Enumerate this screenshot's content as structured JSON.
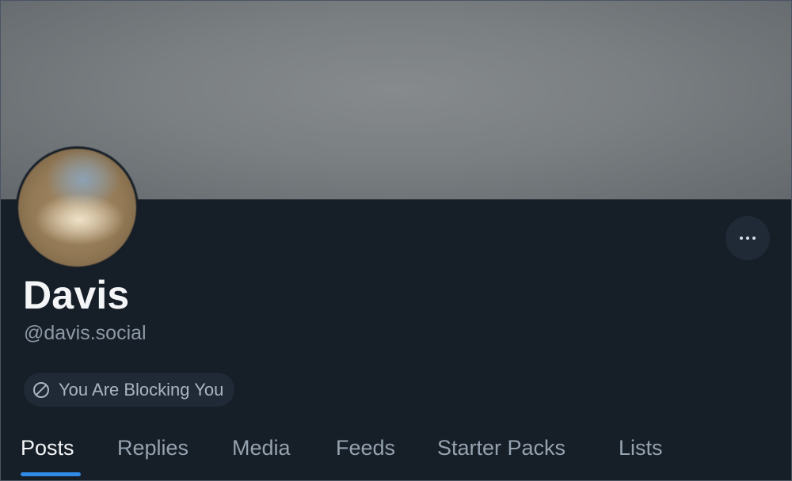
{
  "profile": {
    "display_name": "Davis",
    "handle": "@davis.social",
    "block_status": "You Are Blocking You"
  },
  "icons": {
    "more": "ellipsis-icon",
    "block": "block-icon"
  },
  "tabs": [
    {
      "label": "Posts",
      "active": true
    },
    {
      "label": "Replies",
      "active": false
    },
    {
      "label": "Media",
      "active": false
    },
    {
      "label": "Feeds",
      "active": false
    },
    {
      "label": "Starter Packs",
      "active": false
    },
    {
      "label": "Lists",
      "active": false
    }
  ],
  "colors": {
    "background": "#161e27",
    "accent": "#2f8be6",
    "surface": "#1f2a36"
  }
}
